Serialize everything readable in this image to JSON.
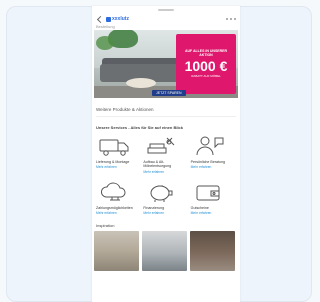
{
  "app": {
    "logo_text": "xxxlutz"
  },
  "breadcrumb": "Bestellung",
  "hero": {
    "promo_headline": "AUF ALLES IN UNSERER AKTION",
    "promo_amount": "1000 €",
    "promo_note": "RABATT AUF MÖBEL",
    "cta_label": "JETZT SPAREN"
  },
  "teaser_text": "Weitere Produkte & Aktionen",
  "services": {
    "title": "Unsere Services - Alles für Sie auf einen Blick",
    "items": [
      {
        "label": "Lieferung & Montage",
        "link": "Mehr erfahren",
        "icon": "truck-icon"
      },
      {
        "label": "Aufbau & Alt-Möbelentsorgung",
        "link": "Mehr erfahren",
        "icon": "sofa-tools-icon"
      },
      {
        "label": "Persönliche Beratung",
        "link": "Mehr erfahren",
        "icon": "advisor-icon"
      },
      {
        "label": "Zahlungsmöglichkeiten",
        "link": "Mehr erfahren",
        "icon": "cloud-payment-icon"
      },
      {
        "label": "Finanzierung",
        "link": "Mehr erfahren",
        "icon": "piggy-bank-icon"
      },
      {
        "label": "Gutscheine",
        "link": "Mehr erfahren",
        "icon": "wallet-icon"
      }
    ]
  },
  "photos_title": "Inspiration"
}
